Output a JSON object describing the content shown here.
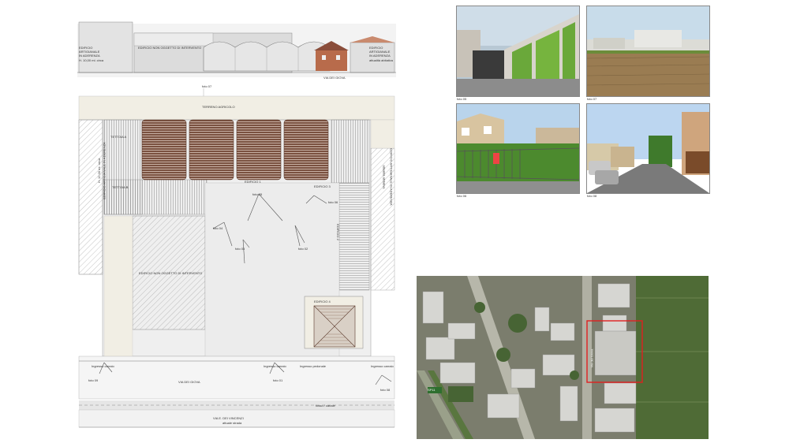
{
  "elevation": {
    "left_building": "EDIFICIO ARTIGIANALE IN ADERENZA",
    "left_building_height": "H. 10,00 ml. circa",
    "center_building": "EDIFICIO NON OGGETTO DI INTERVENTO",
    "right_building": "EDIFICIO ARTIGIANALE IN ADERENZA",
    "right_building_note": "attualità abitativa",
    "street": "VIA DEI GIOVA"
  },
  "plan": {
    "foto_top": "foto 07",
    "terreno": "TERRENO AGRICOLO",
    "tettoia_a": "TETTOIA A",
    "tettoia_b": "TETTOIA B",
    "edificio_1": "EDIFICIO 1",
    "edificio_2": "EDIFICIO 2",
    "edificio_3": "EDIFICIO 3",
    "edificio_4": "EDIFICIO 4",
    "left_side": "EDIFICIO ARTIGIANALE IN ADERENZA",
    "left_side_sub": "H. 12,00 ml. circa",
    "right_side": "EDIFICIO ARTIGIANALE IN ADERENZA",
    "right_side_sub": "attualità abitativa",
    "non_oggetto": "EDIFICIO NON OGGETTO DI INTERVENTO",
    "foto_05": "foto 05",
    "foto_04": "foto 04",
    "foto_03": "foto 03",
    "foto_02": "foto 02",
    "foto_06": "foto 06",
    "foto_01": "foto 01",
    "ingresso_carraio_1": "Ingresso carraio",
    "ingresso_carraio_2": "Ingresso carraio",
    "ingresso_pedonale": "Ingresso pedonale",
    "ingresso_carraio_3": "Ingresso carraio",
    "foto_09": "foto 09",
    "foto_08": "foto 08",
    "via_giova": "VIA DEI GIOVA",
    "fosso": "fosso / canale",
    "road_bottom": "VIA E. DEI VINCENZI",
    "road_bottom_sub": "attuale strada"
  },
  "photos": {
    "p05": "foto 05",
    "p07": "foto 07",
    "p06": "foto 06",
    "p08": "foto 08"
  },
  "aerial": {
    "road_label": "SP11",
    "street_label": "Via dei Giova"
  },
  "colors": {
    "roof_brown": "#7a5140",
    "site_beige": "#f1eee4",
    "hatch": "#9a9a9a",
    "highlight": "#e02020"
  }
}
